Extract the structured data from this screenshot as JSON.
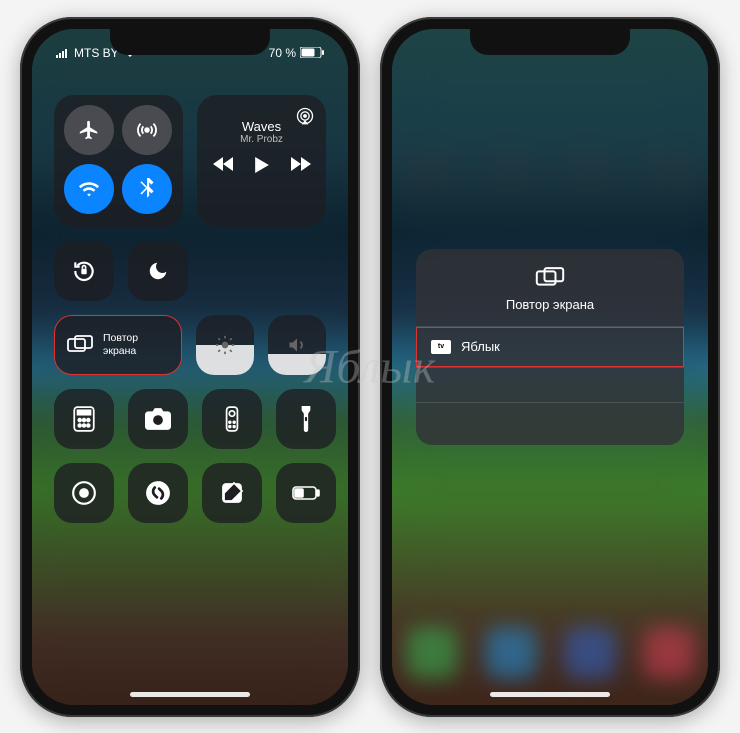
{
  "status": {
    "carrier": "MTS BY",
    "battery": "70 %"
  },
  "connectivity": {
    "airplane": "airplane-icon",
    "airdrop": "airdrop-icon",
    "wifi": "wifi-icon",
    "bluetooth": "bluetooth-icon"
  },
  "media": {
    "title": "Waves",
    "artist": "Mr. Probz"
  },
  "screen_mirror": {
    "line1": "Повтор",
    "line2": "экрана"
  },
  "sliders": {
    "brightness_pct": 50,
    "volume_pct": 35
  },
  "mirror_sheet": {
    "title": "Повтор экрана",
    "device": "Яблык",
    "device_kind": "tv"
  },
  "watermark": "Яблык",
  "colors": {
    "accent_blue": "#0a84ff",
    "highlight_red": "#e03030"
  }
}
